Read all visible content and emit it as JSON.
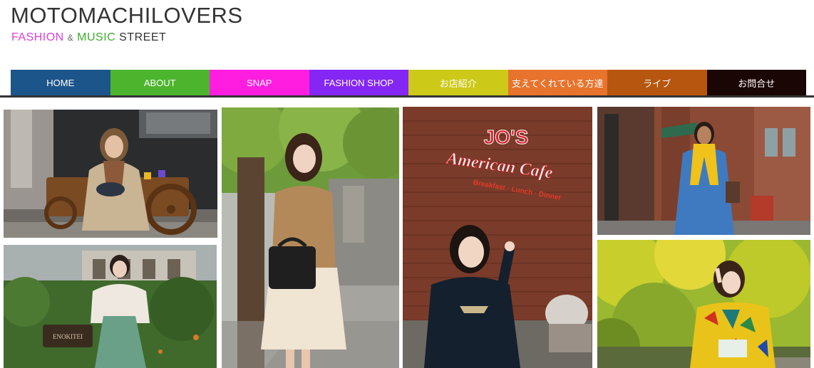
{
  "site": {
    "title": "MOTOMACHILOVERS",
    "tagline": {
      "fashion": "FASHION",
      "amp": "&",
      "music": "MUSIC",
      "street": "STREET"
    }
  },
  "nav": {
    "items": [
      {
        "label": "HOME",
        "color": "#1c558a"
      },
      {
        "label": "ABOUT",
        "color": "#4db52d"
      },
      {
        "label": "SNAP",
        "color": "#ff1ee0"
      },
      {
        "label": "FASHION SHOP",
        "color": "#8426f4"
      },
      {
        "label": "お店紹介",
        "color": "#cdc918"
      },
      {
        "label": "支えてくれている方達",
        "color": "#e8732c"
      },
      {
        "label": "ライブ",
        "color": "#b6560f"
      },
      {
        "label": "お問合せ",
        "color": "#1a0604"
      }
    ]
  },
  "gallery": {
    "cafe_sign": {
      "line1": "JO'S",
      "line2": "American Cafe",
      "line3": "Breakfast · Lunch · Dinner"
    },
    "restaurant_sign": "ENOKITEI"
  }
}
